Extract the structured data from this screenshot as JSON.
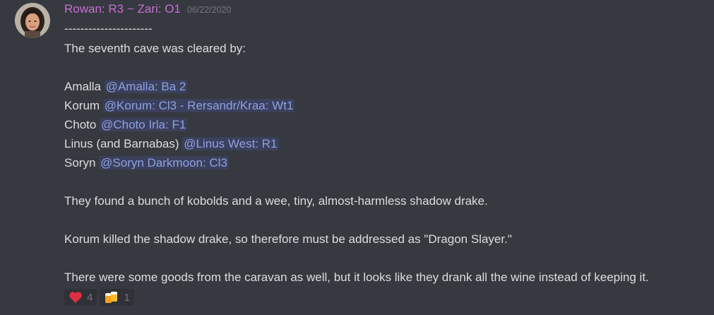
{
  "author": {
    "name": "Rowan: R3 ~ Zari: O1",
    "timestamp": "06/22/2020",
    "color": "#c76fd6"
  },
  "message": {
    "separator": "----------------------",
    "intro": "The seventh cave was cleared by:",
    "party": [
      {
        "name": "Amalla ",
        "mention": "@Amalla: Ba 2"
      },
      {
        "name": "Korum ",
        "mention": "@Korum: Cl3 - Rersandr/Kraa: Wt1"
      },
      {
        "name": "Choto ",
        "mention": "@Choto Irla: F1"
      },
      {
        "name": "Linus (and Barnabas) ",
        "mention": "@Linus West: R1"
      },
      {
        "name": "Soryn ",
        "mention": "@Soryn Darkmoon: Cl3"
      }
    ],
    "paragraph_1": "They found a bunch of kobolds and a wee, tiny, almost-harmless shadow drake.",
    "paragraph_2": "Korum killed the shadow drake, so therefore must be addressed as \"Dragon Slayer.\"",
    "paragraph_3": "There were some goods from the caravan as well, but it looks like they drank all the wine instead of keeping it."
  },
  "reactions": [
    {
      "icon": "heart-icon",
      "count": "4"
    },
    {
      "icon": "beers-icon",
      "count": "1"
    }
  ],
  "colors": {
    "background": "#36393f",
    "text": "#dcddde",
    "mention_text": "#8ea1e1",
    "timestamp": "#72767d"
  }
}
